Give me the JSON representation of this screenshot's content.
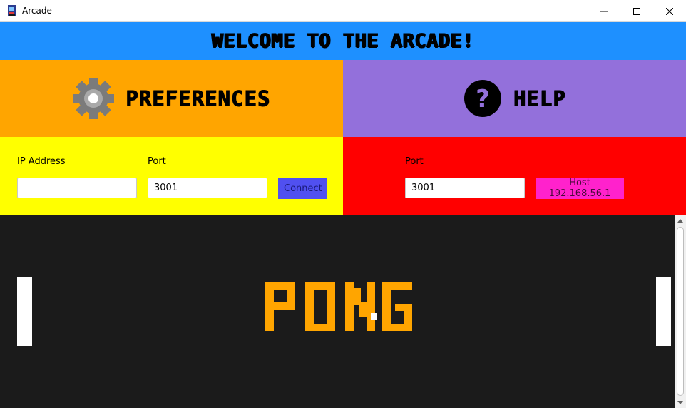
{
  "window": {
    "title": "Arcade",
    "icon": "arcade-cabinet-icon",
    "controls": [
      "minimize-icon",
      "maximize-icon",
      "close-icon"
    ]
  },
  "banner": {
    "text": "WELCOME TO THE ARCADE!",
    "color": "#1e90ff"
  },
  "menu": {
    "preferences": {
      "label": "PREFERENCES",
      "icon": "gear-icon",
      "color": "#ffa500"
    },
    "help": {
      "label": "HELP",
      "icon": "question-mark-icon",
      "color": "#9370db"
    }
  },
  "connect_panel": {
    "color": "#ffff00",
    "ip_label": "IP Address",
    "ip_value": "",
    "port_label": "Port",
    "port_value": "3001",
    "button_label": "Connect"
  },
  "host_panel": {
    "color": "#ff0000",
    "port_label": "Port",
    "port_value": "3001",
    "button_label": "Host 192.168.56.1"
  },
  "game": {
    "title": "PONG",
    "background": "#1b1b1b",
    "logo_color": "#ffa500"
  }
}
